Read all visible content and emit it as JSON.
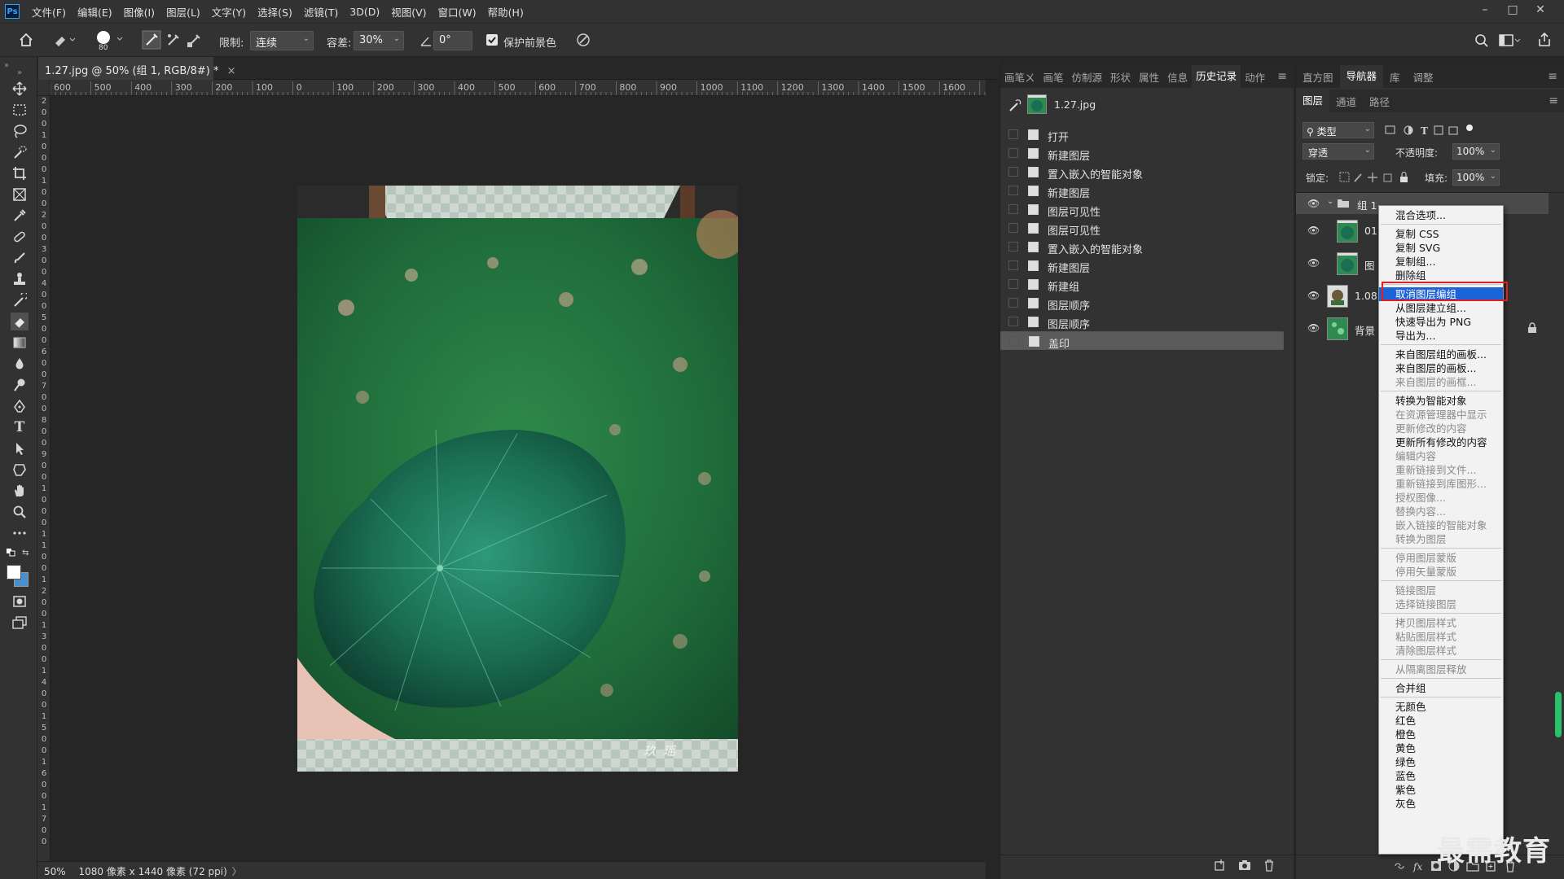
{
  "menubar": {
    "logo": "Ps",
    "items": [
      "文件(F)",
      "编辑(E)",
      "图像(I)",
      "图层(L)",
      "文字(Y)",
      "选择(S)",
      "滤镜(T)",
      "3D(D)",
      "视图(V)",
      "窗口(W)",
      "帮助(H)"
    ],
    "window_controls": [
      "–",
      "□",
      "✕"
    ]
  },
  "options": {
    "brush_size": "80",
    "limit_label": "限制:",
    "limit_value": "连续",
    "tolerance_label": "容差:",
    "tolerance_value": "30%",
    "angle_value": "0°",
    "protect_fg_label": "保护前景色",
    "protect_fg_checked": true
  },
  "document": {
    "tab_title": "1.27.jpg @ 50% (组 1, RGB/8#) *",
    "tab_close": "×",
    "ruler_h": [
      "600",
      "500",
      "400",
      "300",
      "200",
      "100",
      "0",
      "100",
      "200",
      "300",
      "400",
      "500",
      "600",
      "700",
      "800",
      "900",
      "1000",
      "1100",
      "1200",
      "1300",
      "1400",
      "1500",
      "1600"
    ],
    "ruler_v": [
      "2",
      "0",
      "0",
      "1",
      "0",
      "0",
      "0",
      "1",
      "0",
      "0",
      "2",
      "0",
      "0",
      "3",
      "0",
      "0",
      "4",
      "0",
      "0",
      "5",
      "0",
      "0",
      "6",
      "0",
      "0",
      "7",
      "0",
      "0",
      "8",
      "0",
      "0",
      "9",
      "0",
      "0",
      "1",
      "0",
      "0",
      "0",
      "1",
      "1",
      "0",
      "0",
      "1",
      "2",
      "0",
      "0",
      "1",
      "3",
      "0",
      "0",
      "1",
      "4",
      "0",
      "0",
      "1",
      "5",
      "0",
      "0",
      "1",
      "6",
      "0",
      "0",
      "1",
      "7",
      "0",
      "0"
    ],
    "photo_signature": "玖 瑶"
  },
  "status": {
    "zoom": "50%",
    "info": "1080 像素 x 1440 像素 (72 ppi)",
    "arrow": "〉"
  },
  "history_panel": {
    "tabs": [
      "画笔设置",
      "画笔",
      "仿制源",
      "形状",
      "属性",
      "信息",
      "历史记录",
      "动作"
    ],
    "tab_labels": [
      "画笔ㄨ",
      "画笔",
      "仿制源",
      "形状",
      "属性",
      "信息",
      "历史记录",
      "动作"
    ],
    "active_tab": "历史记录",
    "snapshot": "1.27.jpg",
    "steps": [
      "打开",
      "新建图层",
      "置入嵌入的智能对象",
      "新建图层",
      "图层可见性",
      "图层可见性",
      "置入嵌入的智能对象",
      "新建图层",
      "新建组",
      "图层顺序",
      "图层顺序",
      "盖印"
    ],
    "selected_step": "盖印"
  },
  "top_right_tabs": [
    "直方图",
    "导航器",
    "库",
    "调整"
  ],
  "top_right_active": "导航器",
  "layers_panel": {
    "tabs": [
      "图层",
      "通道",
      "路径"
    ],
    "active_tab": "图层",
    "filter_label": "类型",
    "blend_mode": "穿透",
    "opacity_label": "不透明度:",
    "opacity_value": "100%",
    "lock_label": "锁定:",
    "fill_label": "填充:",
    "fill_value": "100%",
    "layers": [
      {
        "name": "组 1",
        "type": "group"
      },
      {
        "name": "01",
        "type": "image"
      },
      {
        "name": "图",
        "type": "image"
      },
      {
        "name": "1.08",
        "type": "image"
      },
      {
        "name": "背景",
        "type": "background"
      }
    ]
  },
  "context_menu": {
    "items": [
      {
        "label": "混合选项...",
        "enabled": true
      },
      {
        "label": "复制 CSS",
        "enabled": true
      },
      {
        "label": "复制 SVG",
        "enabled": true
      },
      {
        "label": "复制组...",
        "enabled": true
      },
      {
        "label": "删除组",
        "enabled": true
      },
      {
        "label": "取消图层编组",
        "enabled": true,
        "highlighted": true
      },
      {
        "label": "从图层建立组...",
        "enabled": true
      },
      {
        "label": "快速导出为 PNG",
        "enabled": true
      },
      {
        "label": "导出为...",
        "enabled": true
      },
      {
        "label": "来自图层组的画板...",
        "enabled": true
      },
      {
        "label": "来自图层的画板...",
        "enabled": true
      },
      {
        "label": "来自图层的画框...",
        "enabled": false
      },
      {
        "label": "转换为智能对象",
        "enabled": true
      },
      {
        "label": "在资源管理器中显示",
        "enabled": false
      },
      {
        "label": "更新修改的内容",
        "enabled": false
      },
      {
        "label": "更新所有修改的内容",
        "enabled": true
      },
      {
        "label": "编辑内容",
        "enabled": false
      },
      {
        "label": "重新链接到文件...",
        "enabled": false
      },
      {
        "label": "重新链接到库图形...",
        "enabled": false
      },
      {
        "label": "授权图像...",
        "enabled": false
      },
      {
        "label": "替换内容...",
        "enabled": false
      },
      {
        "label": "嵌入链接的智能对象",
        "enabled": false
      },
      {
        "label": "转换为图层",
        "enabled": false
      },
      {
        "label": "停用图层蒙版",
        "enabled": false
      },
      {
        "label": "停用矢量蒙版",
        "enabled": false
      },
      {
        "label": "链接图层",
        "enabled": false
      },
      {
        "label": "选择链接图层",
        "enabled": false
      },
      {
        "label": "拷贝图层样式",
        "enabled": false
      },
      {
        "label": "粘贴图层样式",
        "enabled": false
      },
      {
        "label": "清除图层样式",
        "enabled": false
      },
      {
        "label": "从隔离图层释放",
        "enabled": false
      },
      {
        "label": "合并组",
        "enabled": true
      },
      {
        "label": "无颜色",
        "enabled": true
      },
      {
        "label": "红色",
        "enabled": true
      },
      {
        "label": "橙色",
        "enabled": true
      },
      {
        "label": "黄色",
        "enabled": true
      },
      {
        "label": "绿色",
        "enabled": true
      },
      {
        "label": "蓝色",
        "enabled": true
      },
      {
        "label": "紫色",
        "enabled": true
      },
      {
        "label": "灰色",
        "enabled": true
      }
    ]
  },
  "watermark": "最需教育",
  "colors": {
    "ui_bg": "#323232",
    "canvas_bg": "#262626",
    "accent": "#31a8ff",
    "menu_highlight": "#1b63d9",
    "callout": "#e02020"
  }
}
